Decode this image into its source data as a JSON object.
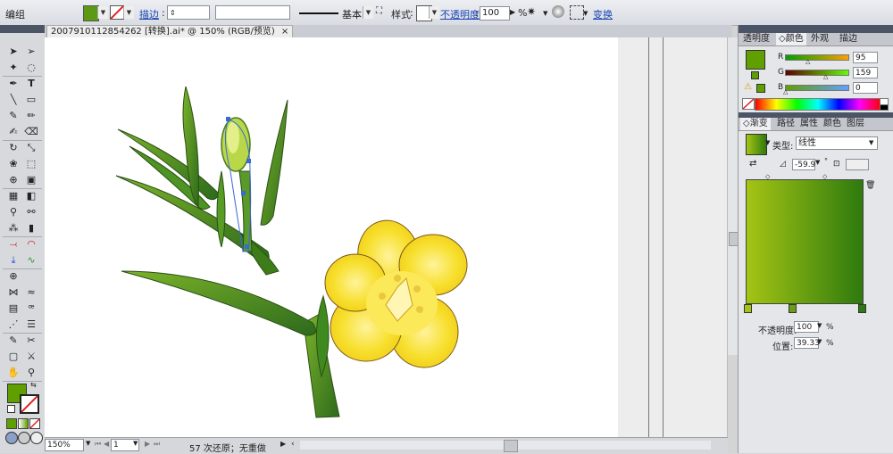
{
  "control_bar": {
    "selection_label": "编组",
    "fill_color": "#5c9a14",
    "stroke_label": "描边",
    "stroke_weight_value": "",
    "brush_value": "",
    "stroke_profile": "基本",
    "style_label": "样式",
    "opacity_label": "不透明度",
    "opacity_value": "100",
    "opacity_unit": "%",
    "transform_label": "变换"
  },
  "document": {
    "tab_title": "2007910112854262 [转换].ai* @ 150% (RGB/预览)",
    "close_glyph": "×"
  },
  "status_bar": {
    "zoom": "150%",
    "artboard_number": "1",
    "status_text": "57 次还原；无重做"
  },
  "color_panel": {
    "tabs": [
      "透明度",
      "颜色",
      "外观",
      "描边"
    ],
    "active_tab": 1,
    "r_label": "R",
    "r_value": "95",
    "g_label": "G",
    "g_value": "159",
    "b_label": "B",
    "b_value": "0",
    "current_color": "#5f9f00"
  },
  "gradient_panel": {
    "tabs": [
      "渐变",
      "路径",
      "属性",
      "颜色",
      "图层"
    ],
    "active_tab": 0,
    "type_label": "类型:",
    "type_value": "线性",
    "angle_value": "-59.9",
    "angle_unit": "°",
    "opacity_label": "不透明度:",
    "opacity_value": "100",
    "location_label": "位置:",
    "location_value": "39.33",
    "percent": "%",
    "start_color": "#a4c414",
    "end_color": "#2e7a0e"
  },
  "colors": {
    "panel_header": "#4c5565",
    "artboard": "#ffffff",
    "link": "#1a45b5"
  }
}
